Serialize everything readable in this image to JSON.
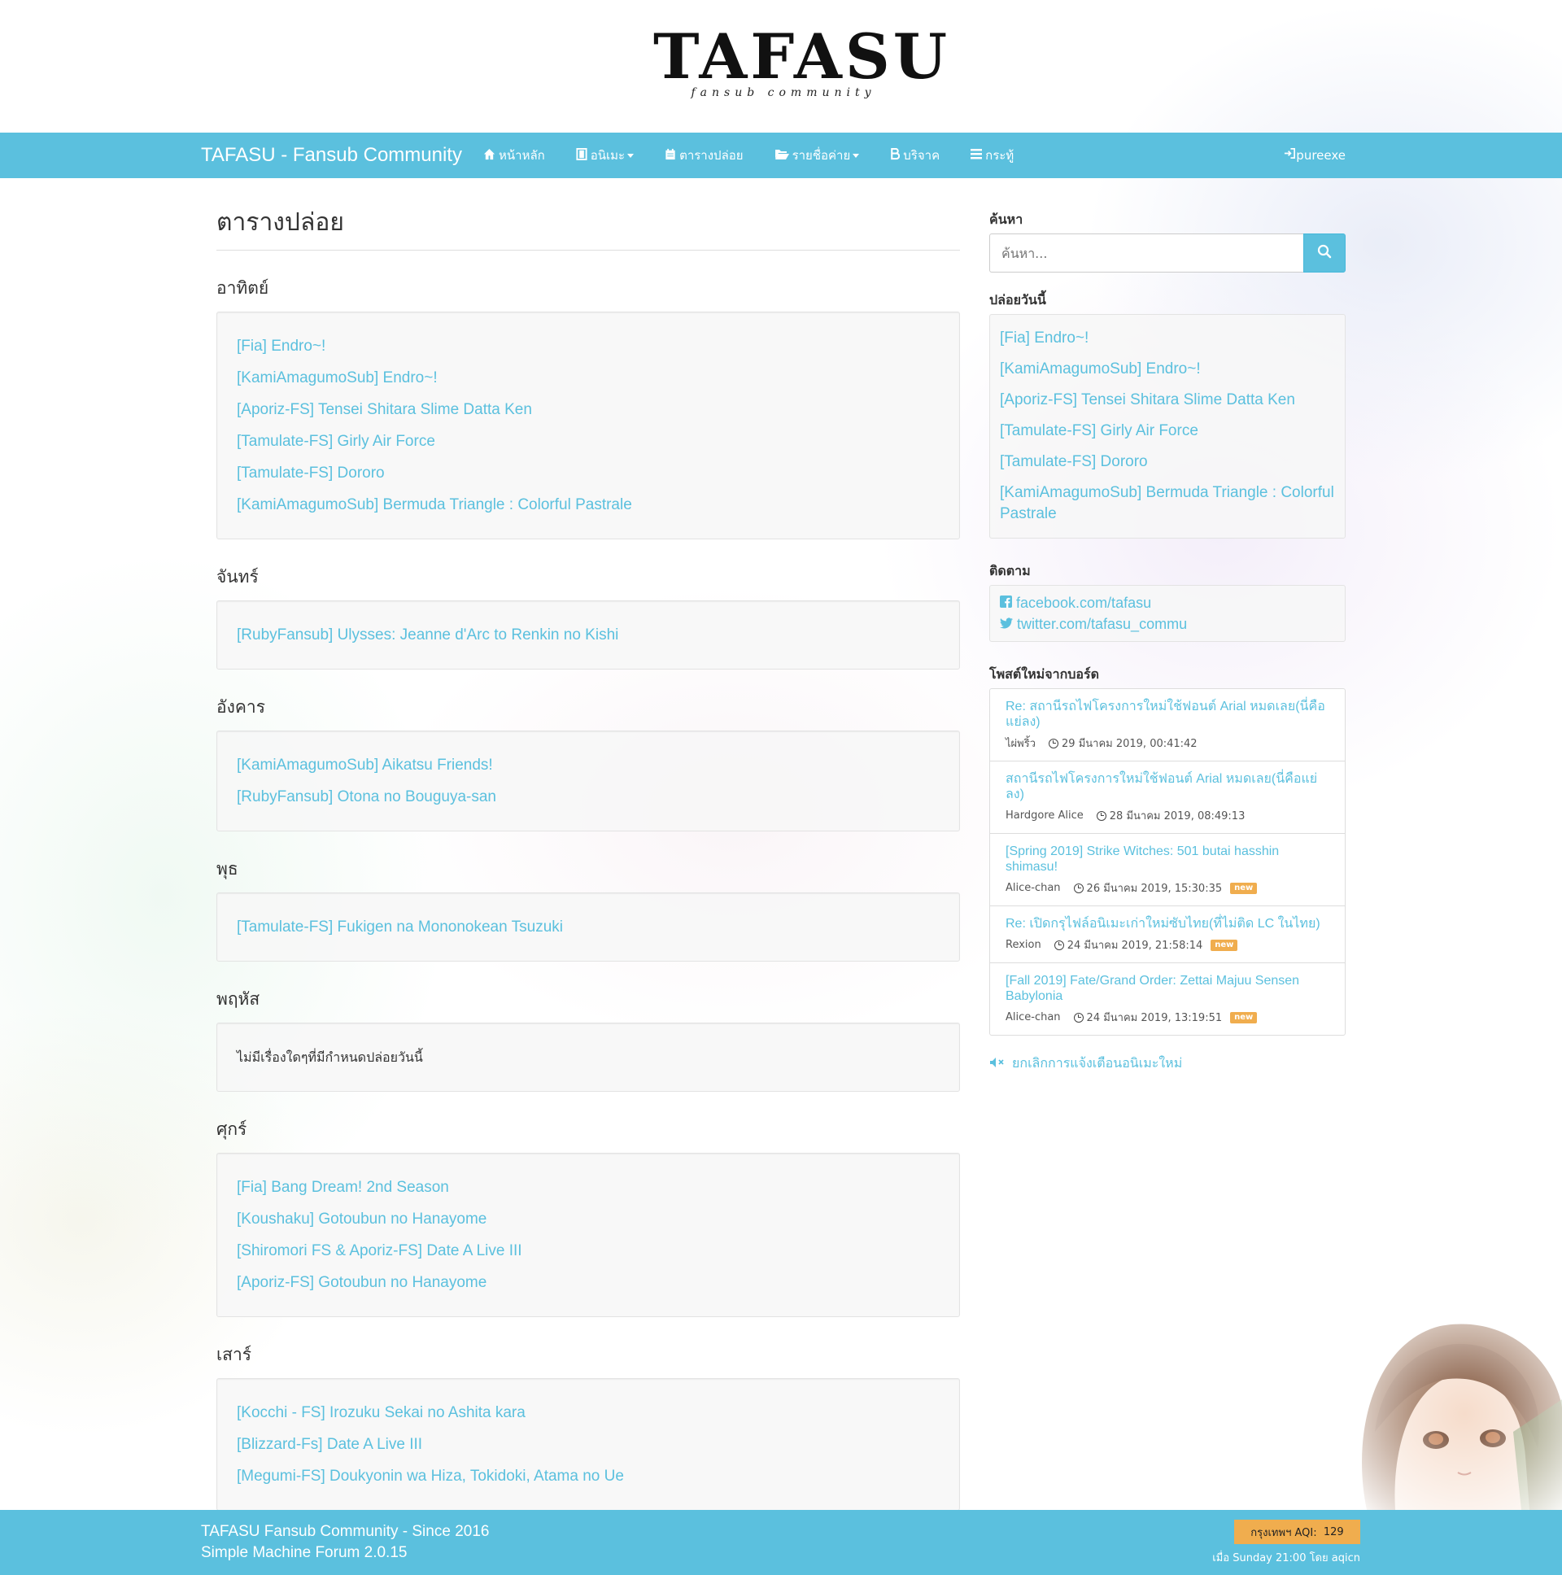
{
  "logo": {
    "title": "TAFASU",
    "subtitle": "fansub community"
  },
  "nav": {
    "brand": "TAFASU - Fansub Community",
    "items": [
      {
        "icon": "home-icon",
        "label": "หน้าหลัก",
        "dropdown": false
      },
      {
        "icon": "film-icon",
        "label": "อนิเมะ",
        "dropdown": true
      },
      {
        "icon": "calendar-icon",
        "label": "ตารางปล่อย",
        "dropdown": false
      },
      {
        "icon": "folder-open-icon",
        "label": "รายชื่อค่าย",
        "dropdown": true
      },
      {
        "icon": "bitcoin-icon",
        "label": "บริจาค",
        "dropdown": false
      },
      {
        "icon": "menu-icon",
        "label": "กระทู้",
        "dropdown": false
      }
    ],
    "login": "pureexe"
  },
  "main": {
    "title": "ตารางปล่อย",
    "days": [
      {
        "name": "อาทิตย์",
        "items": [
          "[Fia] Endro~!",
          "[KamiAmagumoSub] Endro~!",
          "[Aporiz-FS] Tensei Shitara Slime Datta Ken",
          "[Tamulate-FS] Girly Air Force",
          "[Tamulate-FS] Dororo",
          "[KamiAmagumoSub] Bermuda Triangle : Colorful Pastrale"
        ]
      },
      {
        "name": "จันทร์",
        "items": [
          "[RubyFansub] Ulysses: Jeanne d'Arc to Renkin no Kishi"
        ]
      },
      {
        "name": "อังคาร",
        "items": [
          "[KamiAmagumoSub] Aikatsu Friends!",
          "[RubyFansub] Otona no Bouguya-san"
        ]
      },
      {
        "name": "พุธ",
        "items": [
          "[Tamulate-FS] Fukigen na Mononokean Tsuzuki"
        ]
      },
      {
        "name": "พฤหัส",
        "items": [],
        "empty": "ไม่มีเรื่องใดๆที่มีกำหนดปล่อยวันนี้"
      },
      {
        "name": "ศุกร์",
        "items": [
          "[Fia] Bang Dream! 2nd Season",
          "[Koushaku] Gotoubun no Hanayome",
          "[Shiromori FS & Aporiz-FS] Date A Live III",
          "[Aporiz-FS] Gotoubun no Hanayome"
        ]
      },
      {
        "name": "เสาร์",
        "items": [
          "[Kocchi - FS] Irozuku Sekai no Ashita kara",
          "[Blizzard-Fs] Date A Live III",
          "[Megumi-FS] Doukyonin wa Hiza, Tokidoki, Atama no Ue"
        ]
      }
    ]
  },
  "sidebar": {
    "search_heading": "ค้นหา",
    "search_placeholder": "ค้นหา...",
    "today_heading": "ปล่อยวันนี้",
    "today_items": [
      "[Fia] Endro~!",
      "[KamiAmagumoSub] Endro~!",
      "[Aporiz-FS] Tensei Shitara Slime Datta Ken",
      "[Tamulate-FS] Girly Air Force",
      "[Tamulate-FS] Dororo",
      "[KamiAmagumoSub] Bermuda Triangle : Colorful Pastrale"
    ],
    "follow_heading": "ติดตาม",
    "follow_links": [
      {
        "icon": "facebook-icon",
        "label": "facebook.com/tafasu"
      },
      {
        "icon": "twitter-icon",
        "label": "twitter.com/tafasu_commu"
      }
    ],
    "posts_heading": "โพสต์ใหม่จากบอร์ด",
    "posts": [
      {
        "title": "Re: สถานีรถไฟโครงการใหม่ใช้ฟอนต์ Arial หมดเลย(นี่คือแย่ลง)",
        "author": "ไผ่พริ้ว",
        "time": "29 มีนาคม 2019, 00:41:42",
        "new": false
      },
      {
        "title": "สถานีรถไฟโครงการใหม่ใช้ฟอนต์ Arial หมดเลย(นี่คือแย่ลง)",
        "author": "Hardgore Alice",
        "time": "28 มีนาคม 2019, 08:49:13",
        "new": false
      },
      {
        "title": "[Spring 2019] Strike Witches: 501 butai hasshin shimasu!",
        "author": "Alice-chan",
        "time": "26 มีนาคม 2019, 15:30:35",
        "new": true
      },
      {
        "title": "Re: เปิดกรุไฟล์อนิเมะเก่าใหม่ซับไทย(ที่ไม่ติด LC ในไทย)",
        "author": "Rexion",
        "time": "24 มีนาคม 2019, 21:58:14",
        "new": true
      },
      {
        "title": "[Fall 2019] Fate/Grand Order: Zettai Majuu Sensen Babylonia",
        "author": "Alice-chan",
        "time": "24 มีนาคม 2019, 13:19:51",
        "new": true
      }
    ],
    "new_badge": "new",
    "mute_label": "ยกเลิกการแจ้งเตือนอนิเมะใหม่"
  },
  "footer": {
    "line1": "TAFASU Fansub Community - Since 2016",
    "line2": "Simple Machine Forum 2.0.15",
    "aqi_label": "กรุงเทพฯ AQI:",
    "aqi_value": "129",
    "aqi_sub": "เมื่อ Sunday 21:00 โดย aqicn"
  },
  "colors": {
    "accent": "#5bc0de",
    "badge": "#f0ad4e"
  }
}
